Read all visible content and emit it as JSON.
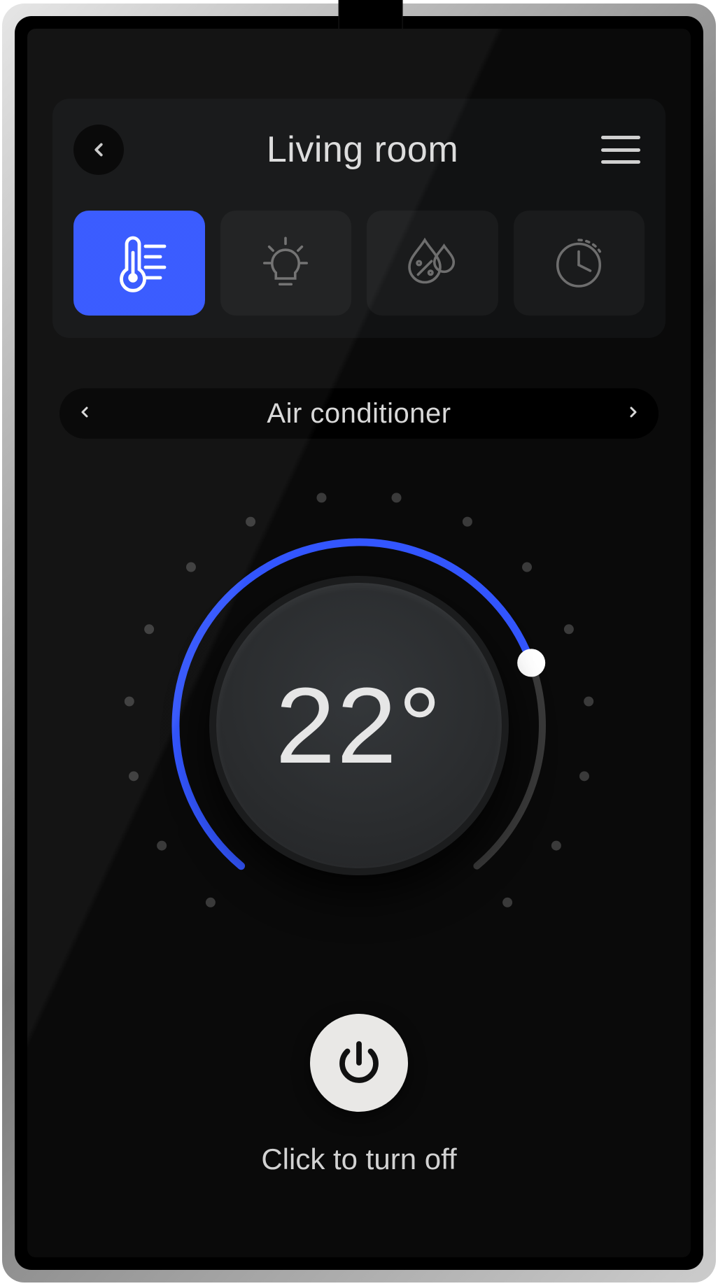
{
  "header": {
    "title": "Living room"
  },
  "tabs": [
    {
      "key": "climate",
      "icon": "thermometer-icon",
      "active": true
    },
    {
      "key": "lighting",
      "icon": "lightbulb-icon",
      "active": false
    },
    {
      "key": "humidity",
      "icon": "humidity-icon",
      "active": false
    },
    {
      "key": "timer",
      "icon": "clock-icon",
      "active": false
    }
  ],
  "device_selector": {
    "label": "Air conditioner"
  },
  "dial": {
    "value_display": "22°",
    "value": 22,
    "unit": "°",
    "progress_fraction": 0.75,
    "tick_count": 16,
    "accent_color": "#3356ff"
  },
  "power": {
    "on": true,
    "label": "Click to turn off"
  }
}
